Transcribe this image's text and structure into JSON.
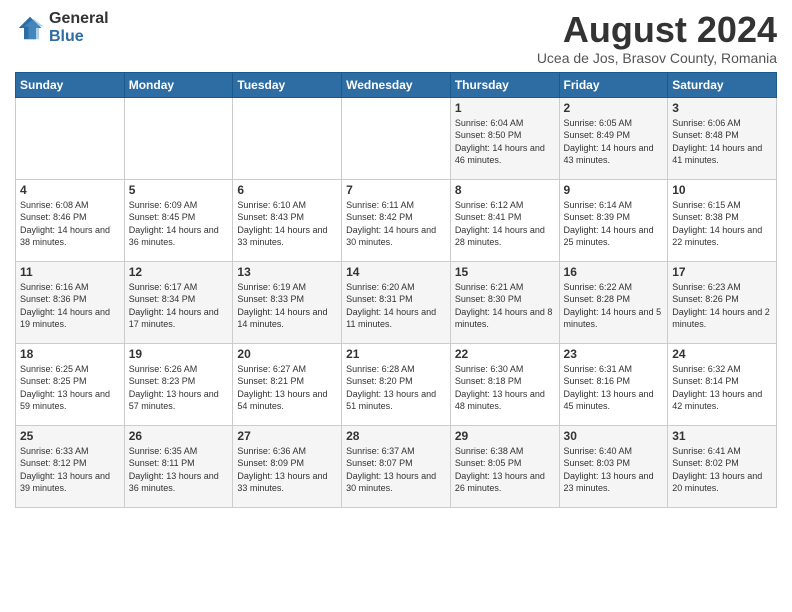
{
  "header": {
    "logo_general": "General",
    "logo_blue": "Blue",
    "month_title": "August 2024",
    "subtitle": "Ucea de Jos, Brasov County, Romania"
  },
  "days_of_week": [
    "Sunday",
    "Monday",
    "Tuesday",
    "Wednesday",
    "Thursday",
    "Friday",
    "Saturday"
  ],
  "weeks": [
    [
      {
        "day": "",
        "info": ""
      },
      {
        "day": "",
        "info": ""
      },
      {
        "day": "",
        "info": ""
      },
      {
        "day": "",
        "info": ""
      },
      {
        "day": "1",
        "info": "Sunrise: 6:04 AM\nSunset: 8:50 PM\nDaylight: 14 hours and 46 minutes."
      },
      {
        "day": "2",
        "info": "Sunrise: 6:05 AM\nSunset: 8:49 PM\nDaylight: 14 hours and 43 minutes."
      },
      {
        "day": "3",
        "info": "Sunrise: 6:06 AM\nSunset: 8:48 PM\nDaylight: 14 hours and 41 minutes."
      }
    ],
    [
      {
        "day": "4",
        "info": "Sunrise: 6:08 AM\nSunset: 8:46 PM\nDaylight: 14 hours and 38 minutes."
      },
      {
        "day": "5",
        "info": "Sunrise: 6:09 AM\nSunset: 8:45 PM\nDaylight: 14 hours and 36 minutes."
      },
      {
        "day": "6",
        "info": "Sunrise: 6:10 AM\nSunset: 8:43 PM\nDaylight: 14 hours and 33 minutes."
      },
      {
        "day": "7",
        "info": "Sunrise: 6:11 AM\nSunset: 8:42 PM\nDaylight: 14 hours and 30 minutes."
      },
      {
        "day": "8",
        "info": "Sunrise: 6:12 AM\nSunset: 8:41 PM\nDaylight: 14 hours and 28 minutes."
      },
      {
        "day": "9",
        "info": "Sunrise: 6:14 AM\nSunset: 8:39 PM\nDaylight: 14 hours and 25 minutes."
      },
      {
        "day": "10",
        "info": "Sunrise: 6:15 AM\nSunset: 8:38 PM\nDaylight: 14 hours and 22 minutes."
      }
    ],
    [
      {
        "day": "11",
        "info": "Sunrise: 6:16 AM\nSunset: 8:36 PM\nDaylight: 14 hours and 19 minutes."
      },
      {
        "day": "12",
        "info": "Sunrise: 6:17 AM\nSunset: 8:34 PM\nDaylight: 14 hours and 17 minutes."
      },
      {
        "day": "13",
        "info": "Sunrise: 6:19 AM\nSunset: 8:33 PM\nDaylight: 14 hours and 14 minutes."
      },
      {
        "day": "14",
        "info": "Sunrise: 6:20 AM\nSunset: 8:31 PM\nDaylight: 14 hours and 11 minutes."
      },
      {
        "day": "15",
        "info": "Sunrise: 6:21 AM\nSunset: 8:30 PM\nDaylight: 14 hours and 8 minutes."
      },
      {
        "day": "16",
        "info": "Sunrise: 6:22 AM\nSunset: 8:28 PM\nDaylight: 14 hours and 5 minutes."
      },
      {
        "day": "17",
        "info": "Sunrise: 6:23 AM\nSunset: 8:26 PM\nDaylight: 14 hours and 2 minutes."
      }
    ],
    [
      {
        "day": "18",
        "info": "Sunrise: 6:25 AM\nSunset: 8:25 PM\nDaylight: 13 hours and 59 minutes."
      },
      {
        "day": "19",
        "info": "Sunrise: 6:26 AM\nSunset: 8:23 PM\nDaylight: 13 hours and 57 minutes."
      },
      {
        "day": "20",
        "info": "Sunrise: 6:27 AM\nSunset: 8:21 PM\nDaylight: 13 hours and 54 minutes."
      },
      {
        "day": "21",
        "info": "Sunrise: 6:28 AM\nSunset: 8:20 PM\nDaylight: 13 hours and 51 minutes."
      },
      {
        "day": "22",
        "info": "Sunrise: 6:30 AM\nSunset: 8:18 PM\nDaylight: 13 hours and 48 minutes."
      },
      {
        "day": "23",
        "info": "Sunrise: 6:31 AM\nSunset: 8:16 PM\nDaylight: 13 hours and 45 minutes."
      },
      {
        "day": "24",
        "info": "Sunrise: 6:32 AM\nSunset: 8:14 PM\nDaylight: 13 hours and 42 minutes."
      }
    ],
    [
      {
        "day": "25",
        "info": "Sunrise: 6:33 AM\nSunset: 8:12 PM\nDaylight: 13 hours and 39 minutes."
      },
      {
        "day": "26",
        "info": "Sunrise: 6:35 AM\nSunset: 8:11 PM\nDaylight: 13 hours and 36 minutes."
      },
      {
        "day": "27",
        "info": "Sunrise: 6:36 AM\nSunset: 8:09 PM\nDaylight: 13 hours and 33 minutes."
      },
      {
        "day": "28",
        "info": "Sunrise: 6:37 AM\nSunset: 8:07 PM\nDaylight: 13 hours and 30 minutes."
      },
      {
        "day": "29",
        "info": "Sunrise: 6:38 AM\nSunset: 8:05 PM\nDaylight: 13 hours and 26 minutes."
      },
      {
        "day": "30",
        "info": "Sunrise: 6:40 AM\nSunset: 8:03 PM\nDaylight: 13 hours and 23 minutes."
      },
      {
        "day": "31",
        "info": "Sunrise: 6:41 AM\nSunset: 8:02 PM\nDaylight: 13 hours and 20 minutes."
      }
    ]
  ]
}
